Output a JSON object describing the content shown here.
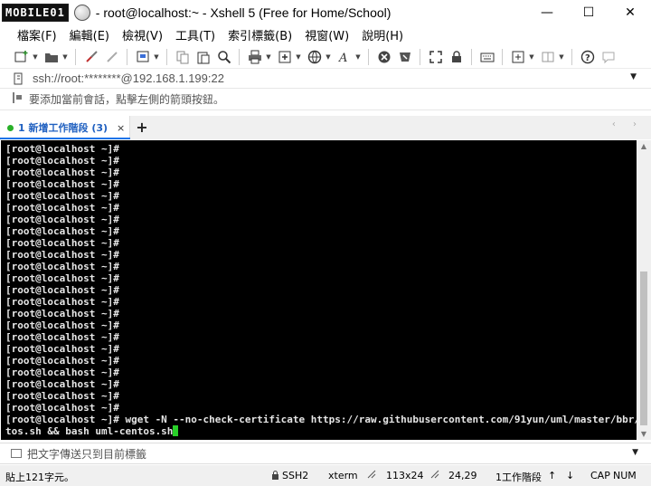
{
  "window": {
    "logo_text": "MOBILE01",
    "title": "- root@localhost:~ - Xshell 5 (Free for Home/School)",
    "minimize": "—",
    "maximize": "☐",
    "close": "✕"
  },
  "menu": {
    "items": [
      "檔案(F)",
      "編輯(E)",
      "檢視(V)",
      "工具(T)",
      "索引標籤(B)",
      "視窗(W)",
      "說明(H)"
    ]
  },
  "address": {
    "value": "ssh://root:********@192.168.1.199:22"
  },
  "hint": {
    "text": "要添加當前會話，點擊左側的箭頭按鈕。"
  },
  "tabs": {
    "items": [
      {
        "label": "1 新增工作階段 (3)",
        "active": true
      }
    ],
    "add_label": "+",
    "close_label": "×",
    "nav_arrows": "‹ ›"
  },
  "terminal": {
    "prompt": "[root@localhost ~]#",
    "empty_prompt_count": 23,
    "command_line_1": "[root@localhost ~]# wget -N --no-check-certificate https://raw.githubusercontent.com/91yun/uml/master/bbr/uml-cen",
    "command_line_2": "tos.sh && bash uml-centos.sh",
    "cursor_color": "#29d029"
  },
  "compose": {
    "placeholder": "把文字傳送只到目前標籤"
  },
  "status": {
    "left": "貼上121字元。",
    "protocol": "SSH2",
    "term": "xterm",
    "size": "113x24",
    "cursor_pos": "24,29",
    "sessions": "1工作階段",
    "caps": "CAP",
    "num": "NUM"
  },
  "colors": {
    "accent": "#1e73e8",
    "active_tab_text": "#2060c0",
    "terminal_bg": "#000000",
    "terminal_fg": "#e6e6e6"
  }
}
